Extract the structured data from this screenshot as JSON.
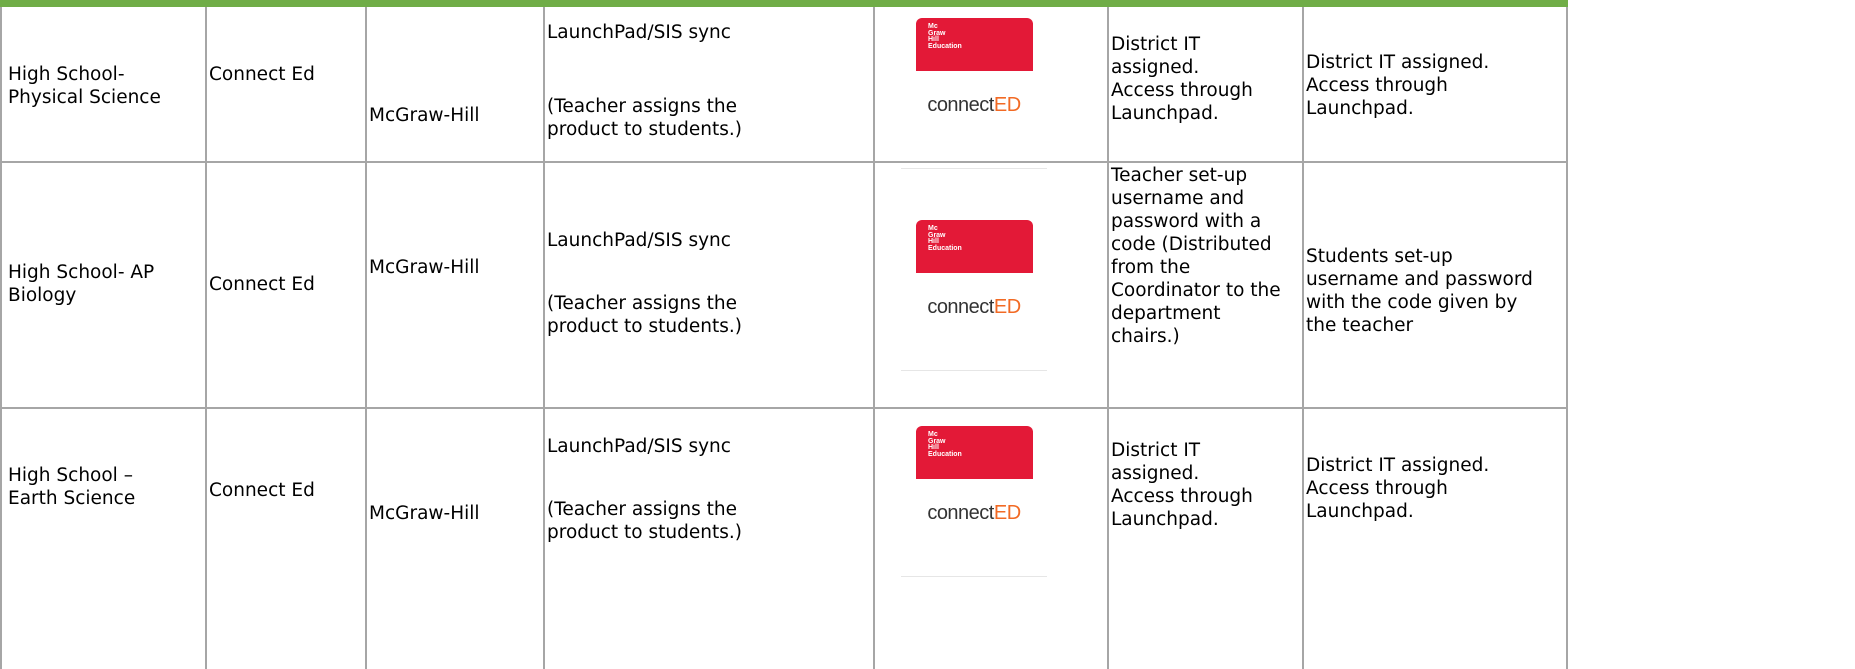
{
  "colors": {
    "header_accent": "#70ad47",
    "logo_red": "#e31937",
    "logo_orange": "#f26a24"
  },
  "logo": {
    "mark": "Mc\nGraw\nHill\nEducation",
    "word_part1": "connect",
    "word_part2": "ED"
  },
  "rows": [
    {
      "course": "High School-\nPhysical Science",
      "product": "Connect Ed",
      "publisher": "McGraw-Hill",
      "sync": "LaunchPad/SIS sync",
      "sync_note": "(Teacher assigns the\nproduct to students.)",
      "teacher_access": "District IT\nassigned.\nAccess through\nLaunchpad.",
      "student_access": "District IT assigned.\nAccess through\nLaunchpad."
    },
    {
      "course": "High School- AP\nBiology",
      "product": "Connect Ed",
      "publisher": "McGraw-Hill",
      "sync": "LaunchPad/SIS sync",
      "sync_note": "(Teacher assigns the\nproduct to students.)",
      "teacher_access": "Teacher set-up\nusername and\npassword with a\ncode (Distributed\nfrom the\nCoordinator to the\ndepartment\nchairs.)",
      "student_access": "Students set-up\nusername and password\nwith the code given by\nthe teacher"
    },
    {
      "course": "High School –\nEarth Science",
      "product": "Connect Ed",
      "publisher": "McGraw-Hill",
      "sync": "LaunchPad/SIS sync",
      "sync_note": "(Teacher assigns the\nproduct to students.)",
      "teacher_access": "District IT\nassigned.\nAccess through\nLaunchpad.",
      "student_access": "District IT assigned.\nAccess through\nLaunchpad."
    }
  ]
}
